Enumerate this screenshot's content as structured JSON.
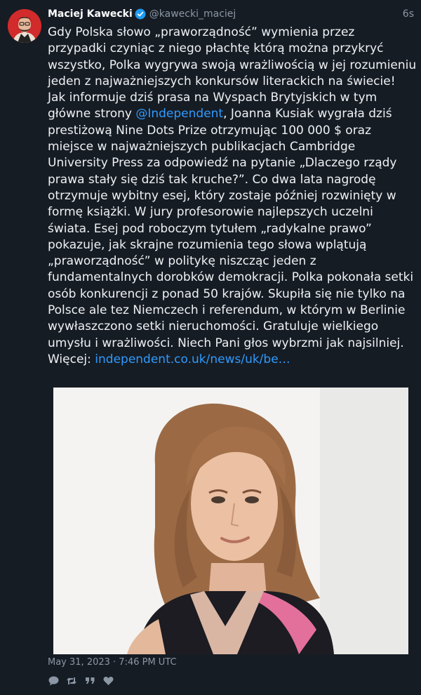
{
  "author": {
    "name": "Maciej Kawecki",
    "handle": "@kawecki_maciej",
    "time_ago": "6s"
  },
  "tweet": {
    "text_part1": "Gdy Polska słowo „praworządność” wymienia przez przypadki czyniąc z niego płachtę którą można przykryć wszystko, Polka wygrywa swoją wrażliwością w jej rozumieniu jeden z najważniejszych konkursów literackich na świecie! Jak informuje dziś prasa na Wyspach Brytyjskich w tym główne strony ",
    "mention": "@Independent",
    "text_part2": ", Joanna Kusiak wygrała dziś prestiżową Nine Dots Prize otrzymując 100 000 $ oraz miejsce w najważniejszych publikacjach Cambridge University Press za odpowiedź na pytanie „Dlaczego rządy prawa stały się dziś tak kruche?”. Co dwa lata nagrodę otrzymuje wybitny esej, który zostaje później rozwinięty w formę książki. W jury profesorowie najlepszych uczelni świata. Esej pod roboczym tytułem „radykalne prawo” pokazuje, jak skrajne rozumienia tego słowa wplątują „praworządność” w politykę niszcząc jeden z fundamentalnych dorobków demokracji. Polka pokonała setki osób konkurencji z ponad 50 krajów. Skupiła się nie tylko na Polsce ale tez Niemczech i referendum, w którym w Berlinie wywłaszczono setki nieruchomości. Gratuluje wielkiego umysłu i wrażliwości. Niech Pani głos wybrzmi jak najsilniej.",
    "more_label": "Więcej: ",
    "more_link": "independent.co.uk/news/uk/be…"
  },
  "timestamp": "May 31, 2023 · 7:46 PM UTC",
  "actions": {
    "reply_icon": "reply-icon",
    "retweet_icon": "retweet-icon",
    "quote_icon": "quote-icon",
    "like_icon": "heart-icon"
  },
  "colors": {
    "background": "#161c24",
    "link": "#2f9bff",
    "muted": "#8b97a4",
    "verified": "#1d9bf0"
  }
}
